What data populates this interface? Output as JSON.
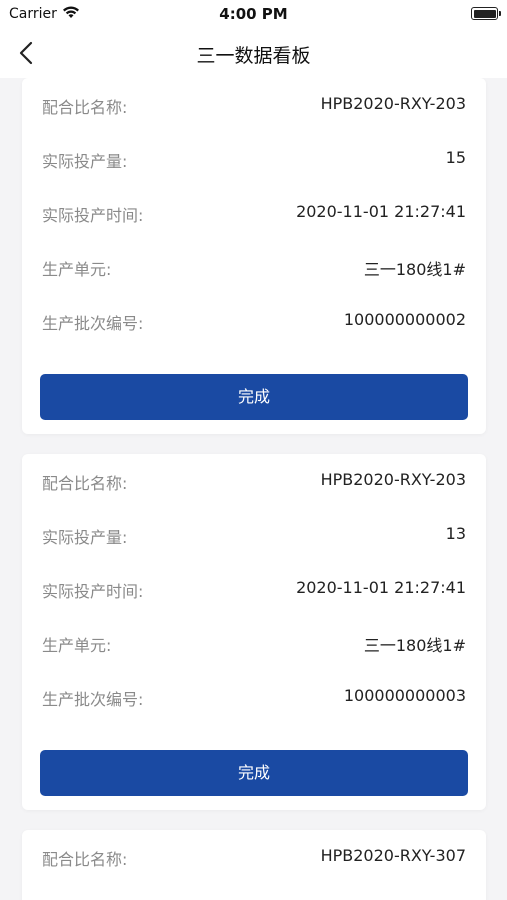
{
  "status_bar": {
    "carrier": "Carrier",
    "time": "4:00 PM"
  },
  "nav": {
    "title": "三一数据看板"
  },
  "labels": {
    "mix_name": "配合比名称:",
    "actual_qty": "实际投产量:",
    "actual_time": "实际投产时间:",
    "unit": "生产单元:",
    "batch_no": "生产批次编号:",
    "complete": "完成"
  },
  "cards": [
    {
      "mix_name": "HPB2020-RXY-203",
      "actual_qty": "15",
      "actual_time": "2020-11-01 21:27:41",
      "unit": "三一180线1#",
      "batch_no": "100000000002"
    },
    {
      "mix_name": "HPB2020-RXY-203",
      "actual_qty": "13",
      "actual_time": "2020-11-01 21:27:41",
      "unit": "三一180线1#",
      "batch_no": "100000000003"
    },
    {
      "mix_name": "HPB2020-RXY-307"
    }
  ]
}
